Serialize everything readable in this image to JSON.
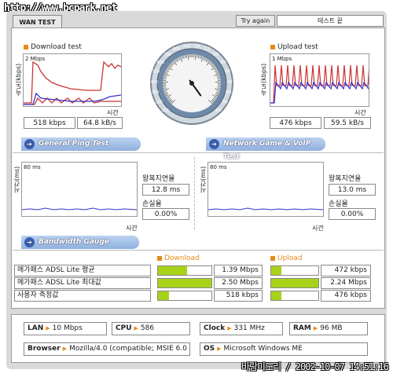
{
  "watermark": "http://www.bcpark.net",
  "header": {
    "tab": "WAN TEST",
    "try_again": "Try again",
    "status": "테스트 끝"
  },
  "download": {
    "title": "Download test",
    "unit": "속도(kbps)",
    "scale": "2 Mbps",
    "time": "시간",
    "kbps": "518 kbps",
    "kbs": "64.8 kB/s"
  },
  "upload": {
    "title": "Upload test",
    "unit": "속도(kbps)",
    "scale": "1 Mbps",
    "time": "시간",
    "kbps": "476 kbps",
    "kbs": "59.5 kB/s"
  },
  "gauge": {
    "ticks": [
      "100",
      "200",
      "300",
      "400",
      "500",
      "600",
      "700",
      "800",
      "900",
      "1M",
      "1.5",
      "2M",
      "3M",
      "4M",
      "5M",
      "6M",
      "7M",
      "8M"
    ],
    "needle_value": "400"
  },
  "ping": {
    "title": "General Ping Test",
    "unit": "시간(ms)",
    "scale": "80 ms",
    "time": "시간",
    "latency_label": "왕복지연율",
    "latency": "12.8 ms",
    "loss_label": "손실율",
    "loss": "0.00%"
  },
  "game": {
    "title": "Network Game & VoIP Test",
    "unit": "시간(ms)",
    "scale": "80 ms",
    "time": "시간",
    "latency_label": "왕복지연율",
    "latency": "13.0 ms",
    "loss_label": "손실율",
    "loss": "0.00%"
  },
  "bandwidth": {
    "title": "Bandwidth Gauge",
    "download_header": "Download",
    "upload_header": "Upload",
    "rows": [
      {
        "label": "메가패스 ADSL Lite 평균",
        "down": "1.39 Mbps",
        "down_pct": 0.55,
        "up": "472 kbps",
        "up_pct": 0.21
      },
      {
        "label": "메가패스 ADSL Lite 최대값",
        "down": "2.50 Mbps",
        "down_pct": 1.0,
        "up": "2.24 Mbps",
        "up_pct": 1.0
      },
      {
        "label": "사용자 측정값",
        "down": "518 kbps",
        "down_pct": 0.21,
        "up": "476 kbps",
        "up_pct": 0.21
      }
    ]
  },
  "sysinfo": {
    "lan_label": "LAN",
    "lan": "10 Mbps",
    "cpu_label": "CPU",
    "cpu": "586",
    "clock_label": "Clock",
    "clock": "331 MHz",
    "ram_label": "RAM",
    "ram": "96 MB",
    "browser_label": "Browser",
    "browser": "Mozilla/4.0 (compatible; MSIE 6.0",
    "os_label": "OS",
    "os": "Microsoft Windows ME"
  },
  "footer_stamp": "바람미도리 / 2002-10-07 14:51:16",
  "colors": {
    "accent_orange": "#e88a1a",
    "bar_green": "#a8d21a",
    "pill_blue": "#8fb0df"
  }
}
